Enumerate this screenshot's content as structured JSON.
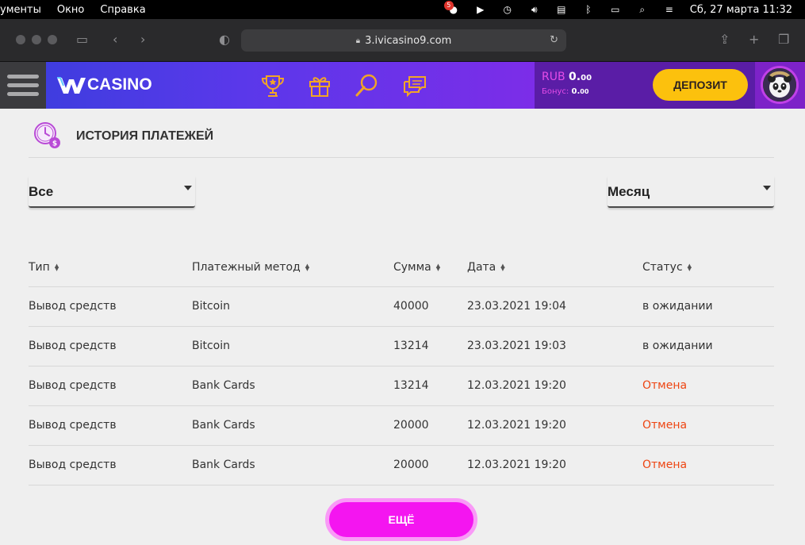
{
  "menubar": {
    "items": [
      "ументы",
      "Окно",
      "Справка"
    ],
    "notification_count": "5",
    "datetime": "Сб, 27 марта  11:32"
  },
  "browser": {
    "url": "3.ivicasino9.com"
  },
  "header": {
    "logo_text": "CASINO",
    "currency": "RUB",
    "balance": "0.",
    "balance_dec": "00",
    "bonus_label": "Бонус:",
    "bonus": "0.",
    "bonus_dec": "00",
    "deposit_label": "ДЕПОЗИТ",
    "brand_color": "#5a38ea",
    "accent_color": "#fcc10d"
  },
  "page": {
    "title": "ИСТОРИЯ ПЛАТЕЖЕЙ",
    "filter_type": "Все",
    "filter_period": "Месяц",
    "more_label": "ЕЩЁ"
  },
  "table": {
    "headers": [
      "Тип",
      "Платежный метод",
      "Сумма",
      "Дата",
      "Статус"
    ],
    "rows": [
      {
        "type": "Вывод средств",
        "method": "Bitcoin",
        "amount": "40000",
        "date": "23.03.2021 19:04",
        "status": "в ожидании"
      },
      {
        "type": "Вывод средств",
        "method": "Bitcoin",
        "amount": "13214",
        "date": "23.03.2021 19:03",
        "status": "в ожидании"
      },
      {
        "type": "Вывод средств",
        "method": "Bank Cards",
        "amount": "13214",
        "date": "12.03.2021 19:20",
        "status": "Отмена"
      },
      {
        "type": "Вывод средств",
        "method": "Bank Cards",
        "amount": "20000",
        "date": "12.03.2021 19:20",
        "status": "Отмена"
      },
      {
        "type": "Вывод средств",
        "method": "Bank Cards",
        "amount": "20000",
        "date": "12.03.2021 19:20",
        "status": "Отмена"
      }
    ]
  }
}
